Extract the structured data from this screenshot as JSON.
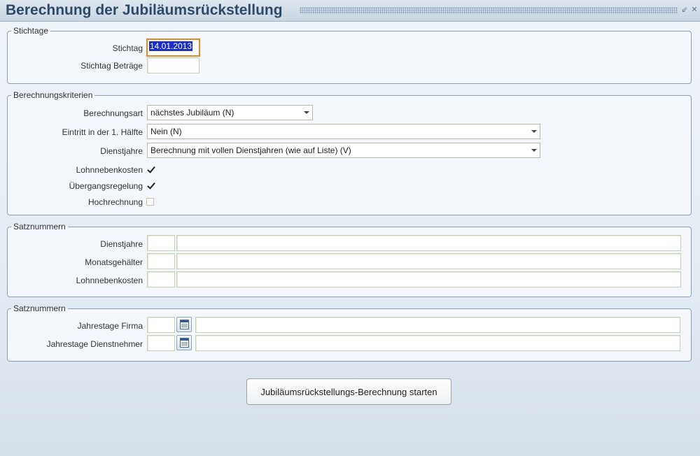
{
  "window": {
    "title": "Berechnung der Jubiläumsrückstellung"
  },
  "stichtage": {
    "legend": "Stichtage",
    "stichtag_label": "Stichtag",
    "stichtag_value": "14.01.2013",
    "stichtag_betraege_label": "Stichtag Beträge",
    "stichtag_betraege_value": ""
  },
  "kriterien": {
    "legend": "Berechnungskriterien",
    "berechnungsart_label": "Berechnungsart",
    "berechnungsart_value": "nächstes Jubiläum (N)",
    "eintritt_label": "Eintritt in der 1. Hälfte",
    "eintritt_value": "Nein (N)",
    "dienstjahre_label": "Dienstjahre",
    "dienstjahre_value": "Berechnung mit vollen Dienstjahren (wie auf Liste) (V)",
    "lohnnebenkosten_label": "Lohnnebenkosten",
    "lohnnebenkosten_checked": true,
    "uebergang_label": "Übergangsregelung",
    "uebergang_checked": true,
    "hochrechnung_label": "Hochrechnung",
    "hochrechnung_checked": false
  },
  "satznummern1": {
    "legend": "Satznummern",
    "dienstjahre_label": "Dienstjahre",
    "monatsgehaelter_label": "Monatsgehälter",
    "lohnnebenkosten_label": "Lohnnebenkosten"
  },
  "satznummern2": {
    "legend": "Satznummern",
    "jahrestage_firma_label": "Jahrestage Firma",
    "jahrestage_dn_label": "Jahrestage Dienstnehmer"
  },
  "actions": {
    "start_label": "Jubiläumsrückstellungs-Berechnung starten"
  }
}
